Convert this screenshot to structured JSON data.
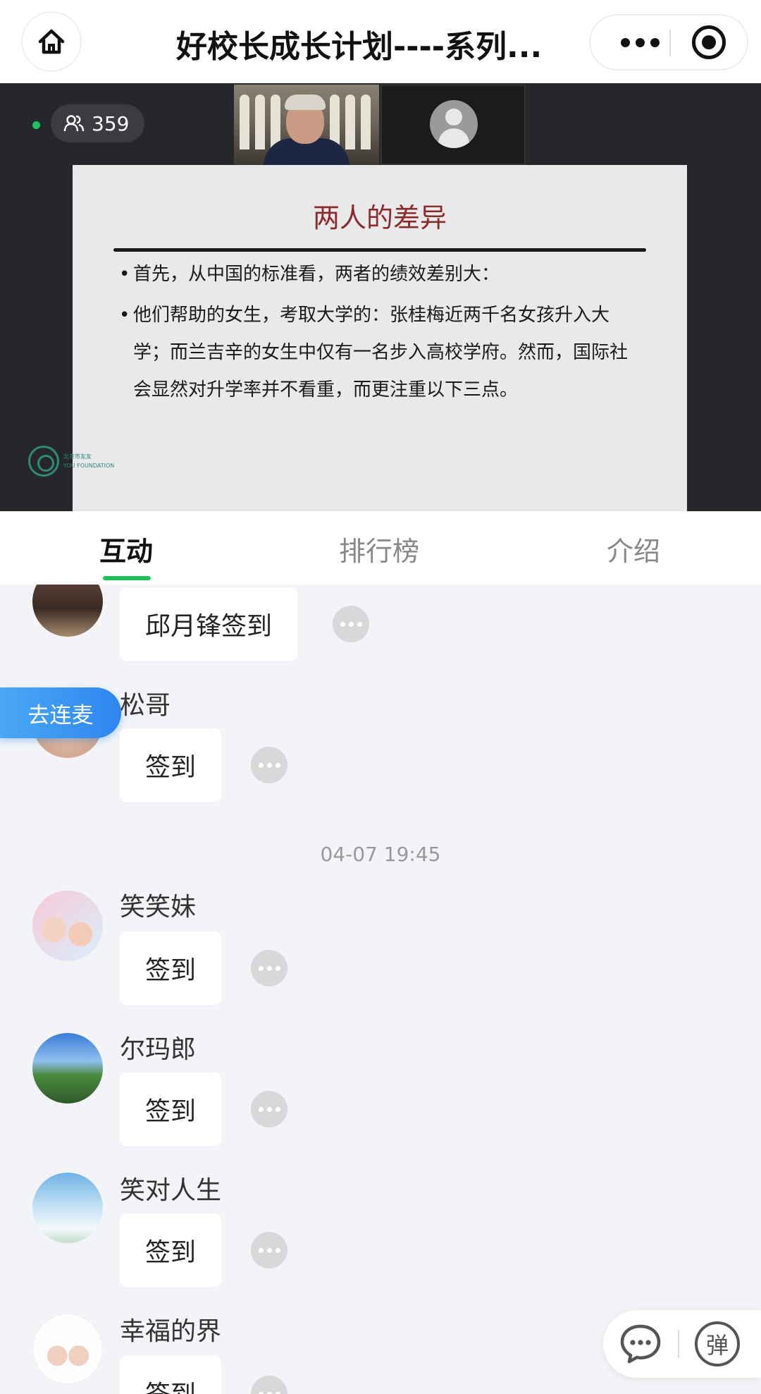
{
  "header": {
    "title": "好校长成长计划----系列...",
    "home_icon": "home-icon",
    "more_icon": "more-icon",
    "close_icon": "target-icon"
  },
  "live": {
    "viewer_count": "359",
    "status_color": "#1ec25b"
  },
  "slide": {
    "title": "两人的差异",
    "bullets": [
      "首先，从中国的标准看，两者的绩效差别大：",
      "他们帮助的女生，考取大学的：张桂梅近两千名女孩升入大学；而兰吉辛的女生中仅有一名步入高校学府。然而，国际社会显然对升学率并不看重，而更注重以下三点。"
    ],
    "bullet_marker": "•",
    "logo_line1": "北京市友友",
    "logo_line2": "YOU FOUNDATION"
  },
  "tabs": [
    {
      "label": "互动",
      "active": true
    },
    {
      "label": "排行榜",
      "active": false
    },
    {
      "label": "介绍",
      "active": false
    }
  ],
  "chat": {
    "join_mic_label": "去连麦",
    "timestamp": "04-07 19:45",
    "messages": [
      {
        "nick": "",
        "text": "邱月锋签到"
      },
      {
        "nick": "松哥",
        "text": "签到"
      },
      {
        "nick": "笑笑妹",
        "text": "签到"
      },
      {
        "nick": "尔玛郎",
        "text": "签到"
      },
      {
        "nick": "笑对人生",
        "text": "签到"
      },
      {
        "nick": "幸福的界",
        "text": "签到"
      }
    ]
  },
  "float_bar": {
    "danmu_label": "弹"
  },
  "colors": {
    "accent": "#1ec25b",
    "mic_blue": "#2e86ee",
    "slide_title": "#8a2a2a"
  }
}
